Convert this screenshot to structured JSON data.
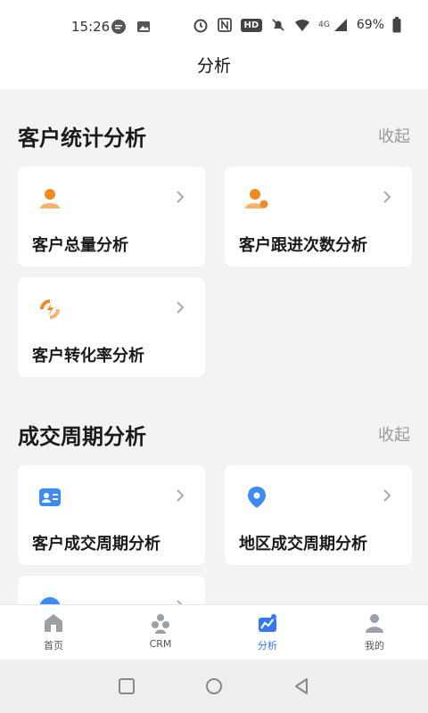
{
  "status_bar": {
    "time": "15:26",
    "hd_badge": "HD",
    "network": "4G",
    "battery": "69%"
  },
  "header": {
    "title": "分析"
  },
  "sections": [
    {
      "title": "客户统计分析",
      "toggle": "收起",
      "cards": [
        {
          "label": "客户总量分析",
          "icon": "person-icon"
        },
        {
          "label": "客户跟进次数分析",
          "icon": "person-followup-icon"
        },
        {
          "label": "客户转化率分析",
          "icon": "conversion-icon"
        }
      ]
    },
    {
      "title": "成交周期分析",
      "toggle": "收起",
      "cards": [
        {
          "label": "客户成交周期分析",
          "icon": "contact-card-icon"
        },
        {
          "label": "地区成交周期分析",
          "icon": "location-pin-icon"
        }
      ]
    }
  ],
  "tabbar": {
    "items": [
      {
        "label": "首页",
        "icon": "home-icon"
      },
      {
        "label": "CRM",
        "icon": "crm-icon"
      },
      {
        "label": "分析",
        "icon": "analysis-icon",
        "active": true
      },
      {
        "label": "我的",
        "icon": "profile-icon"
      }
    ]
  },
  "colors": {
    "accent_blue": "#3478f6",
    "accent_orange": "#f08a24",
    "page_bg": "#f2f3f5"
  }
}
